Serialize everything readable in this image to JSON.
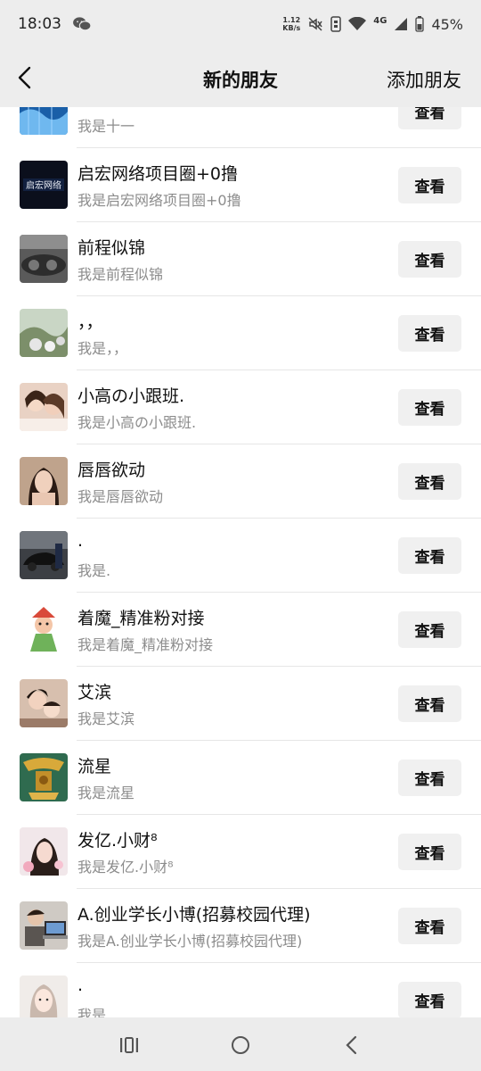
{
  "status_bar": {
    "time": "18:03",
    "net_speed_value": "1.12",
    "net_speed_unit": "KB/s",
    "network_type": "4G",
    "battery": "45%"
  },
  "nav": {
    "title": "新的朋友",
    "action": "添加朋友"
  },
  "friends": [
    {
      "name": "·",
      "sub": "我是十一",
      "button": "查看",
      "avatar": "blue-water-icon"
    },
    {
      "name": "启宏网络项目圈+0撸",
      "sub": "我是启宏网络项目圈+0撸",
      "button": "查看",
      "avatar": "logo-dark",
      "avatar_text": "启宏网络"
    },
    {
      "name": "前程似锦",
      "sub": "我是前程似锦",
      "button": "查看",
      "avatar": "car-interior"
    },
    {
      "name": "，，",
      "sub": "我是，，",
      "button": "查看",
      "avatar": "landscape"
    },
    {
      "name": "小高の小跟班.",
      "sub": "我是小高の小跟班.",
      "button": "查看",
      "avatar": "people-photo"
    },
    {
      "name": "唇唇欲动",
      "sub": "我是唇唇欲动",
      "button": "查看",
      "avatar": "portrait"
    },
    {
      "name": ".",
      "sub": "我是.",
      "button": "查看",
      "avatar": "dark-car"
    },
    {
      "name": "着魔_精准粉对接",
      "sub": "我是着魔_精准粉对接",
      "button": "查看",
      "avatar": "cartoon"
    },
    {
      "name": "艾滨",
      "sub": "我是艾滨",
      "button": "查看",
      "avatar": "family-photo"
    },
    {
      "name": "流星",
      "sub": "我是流星",
      "button": "查看",
      "avatar": "golden-vessel"
    },
    {
      "name": "发亿.小财⁸",
      "sub": "我是发亿.小财⁸",
      "button": "查看",
      "avatar": "girl-flowers"
    },
    {
      "name": "A.创业学长小博(招募校园代理)",
      "sub": "我是A.创业学长小博(招募校园代理)",
      "button": "查看",
      "avatar": "laptop-person"
    },
    {
      "name": ".",
      "sub": "我是.",
      "button": "查看",
      "avatar": "girl-light"
    }
  ],
  "colors": {
    "header_bg": "#ededed",
    "button_bg": "#f0f0f0",
    "sub_text": "#8c8c8c"
  }
}
